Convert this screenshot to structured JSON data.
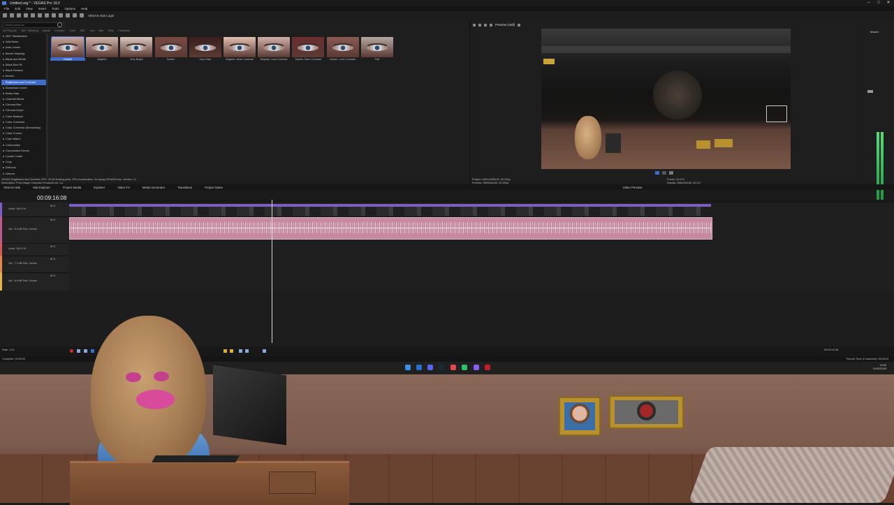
{
  "window": {
    "title": "Untitled.veg * - VEGAS Pro 19.0"
  },
  "menu": [
    "File",
    "Edit",
    "View",
    "Insert",
    "Tools",
    "Options",
    "Help"
  ],
  "toolbar": {
    "hub": "VEGAS Hub Login"
  },
  "fx": {
    "search_placeholder": "Search plug-ins",
    "tabs": [
      "All Plug-ins",
      "360° Stitching",
      "Adjust",
      "Creative",
      "Color",
      "360°",
      "Key",
      "Blur",
      "Time",
      "Favorites"
    ],
    "items": [
      "360° Stabilization",
      "Add Noise",
      "Auto Levels",
      "Bezier Masking",
      "Black and White",
      "Black Bar Fill",
      "Black Restore",
      "Border",
      "Brightness and Contrast",
      "Broadcast Colors",
      "Bump Map",
      "Channel Blend",
      "Chroma Blur",
      "Chroma Keyer",
      "Color Balance",
      "Color Corrector",
      "Color Corrector (Secondary)",
      "Color Curves",
      "Color Match",
      "Colorization",
      "Convolution Kernel",
      "Cookie Cutter",
      "Crop",
      "Defocus",
      "Deform"
    ],
    "selected_index": 8,
    "presets": [
      "Default",
      "Brighter",
      "Very Bright",
      "Darker",
      "Very Dark",
      "Brighter, More Contrast",
      "Brighter, Less Contrast",
      "Darker, More Contrast",
      "Darker, Less Contrast",
      "Flat"
    ],
    "preset_colors": [
      "#c8a5a0",
      "#cfb4ac",
      "#dcc8c0",
      "#7a4a44",
      "#3a1e1e",
      "#e3c0b0",
      "#d0b0a8",
      "#6a2e2e",
      "#8a5a54",
      "#b5a8a2"
    ],
    "selected_preset": 0,
    "description_line1": "VEGAS Brightness and Contrast: OFX, 32-bit floating point, GPU Accelerated, Grouping VEGAS\\Color, Version 1.0",
    "description_line2": "Description: From Magix Computer Products Intl. Co."
  },
  "preview": {
    "mode": "Preview (Half)",
    "project": "Project: 1920x1080x32, 60.000p",
    "preview_res": "Preview: 960x540x32, 60.000p",
    "video_preview": "Video Preview",
    "frame": "Frame: 33,374",
    "display": "Display: 356x200x32, 60.117"
  },
  "master": {
    "label": "Master",
    "bus": "Master Bus"
  },
  "bottom_tabs": [
    "VEGAS Hub",
    "Hub Explorer",
    "Project Media",
    "Explorer",
    "Video FX",
    "Media Generator",
    "Transitions",
    "Project Notes"
  ],
  "timeline": {
    "timecode": "00:09:16:08",
    "tracks": [
      {
        "label": "Level: 100.0 %",
        "color": "#7a5ec4"
      },
      {
        "label": "Vol: -5.9 dB  Pan: Center",
        "color": "#c05a8a"
      },
      {
        "label": "Level: 100.0 %",
        "color": "#d65a5a"
      },
      {
        "label": "Vol: -7.1 dB  Pan: Center",
        "color": "#e08a4a"
      },
      {
        "label": "Vol: -6.5 dB  Pan: Center",
        "color": "#e6b44a"
      }
    ]
  },
  "transport": {
    "rate": "Rate: 1.00"
  },
  "status": {
    "complete": "Complete: 00:00:00",
    "record_time": "Record Time (2 channels): 55:35:00",
    "time": "00:09:16:08"
  },
  "taskbar": {
    "clock": "16:56",
    "date": "01/05/2026"
  }
}
